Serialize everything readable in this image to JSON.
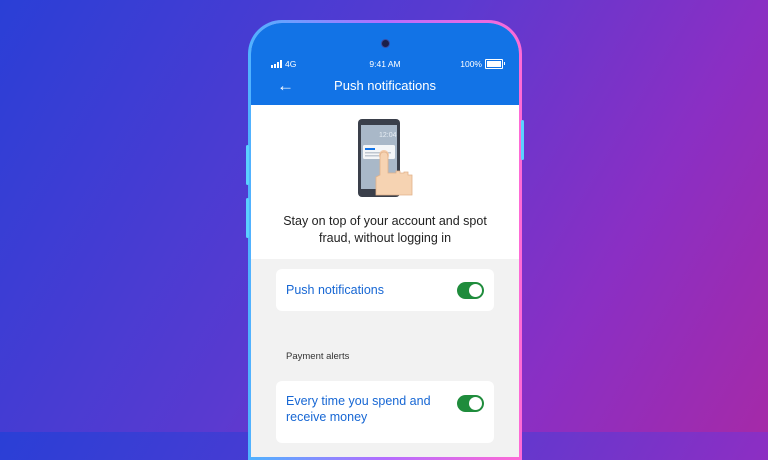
{
  "status_bar": {
    "network": "4G",
    "time": "9:41 AM",
    "battery": "100%"
  },
  "header": {
    "back_icon": "arrow-left-icon",
    "title": "Push notifications"
  },
  "hero": {
    "illustration": "phone-notification-hand-illustration",
    "illustration_time": "12:04",
    "description": "Stay on top of your account and spot fraud, without logging in"
  },
  "settings": {
    "push_toggle": {
      "label": "Push notifications",
      "enabled": true
    },
    "section_heading": "Payment alerts",
    "payment_toggle": {
      "label": "Every time you spend and receive money",
      "enabled": true
    }
  },
  "colors": {
    "header_blue": "#1273e6",
    "link_blue": "#1767d4",
    "toggle_green": "#1f8c3c"
  }
}
